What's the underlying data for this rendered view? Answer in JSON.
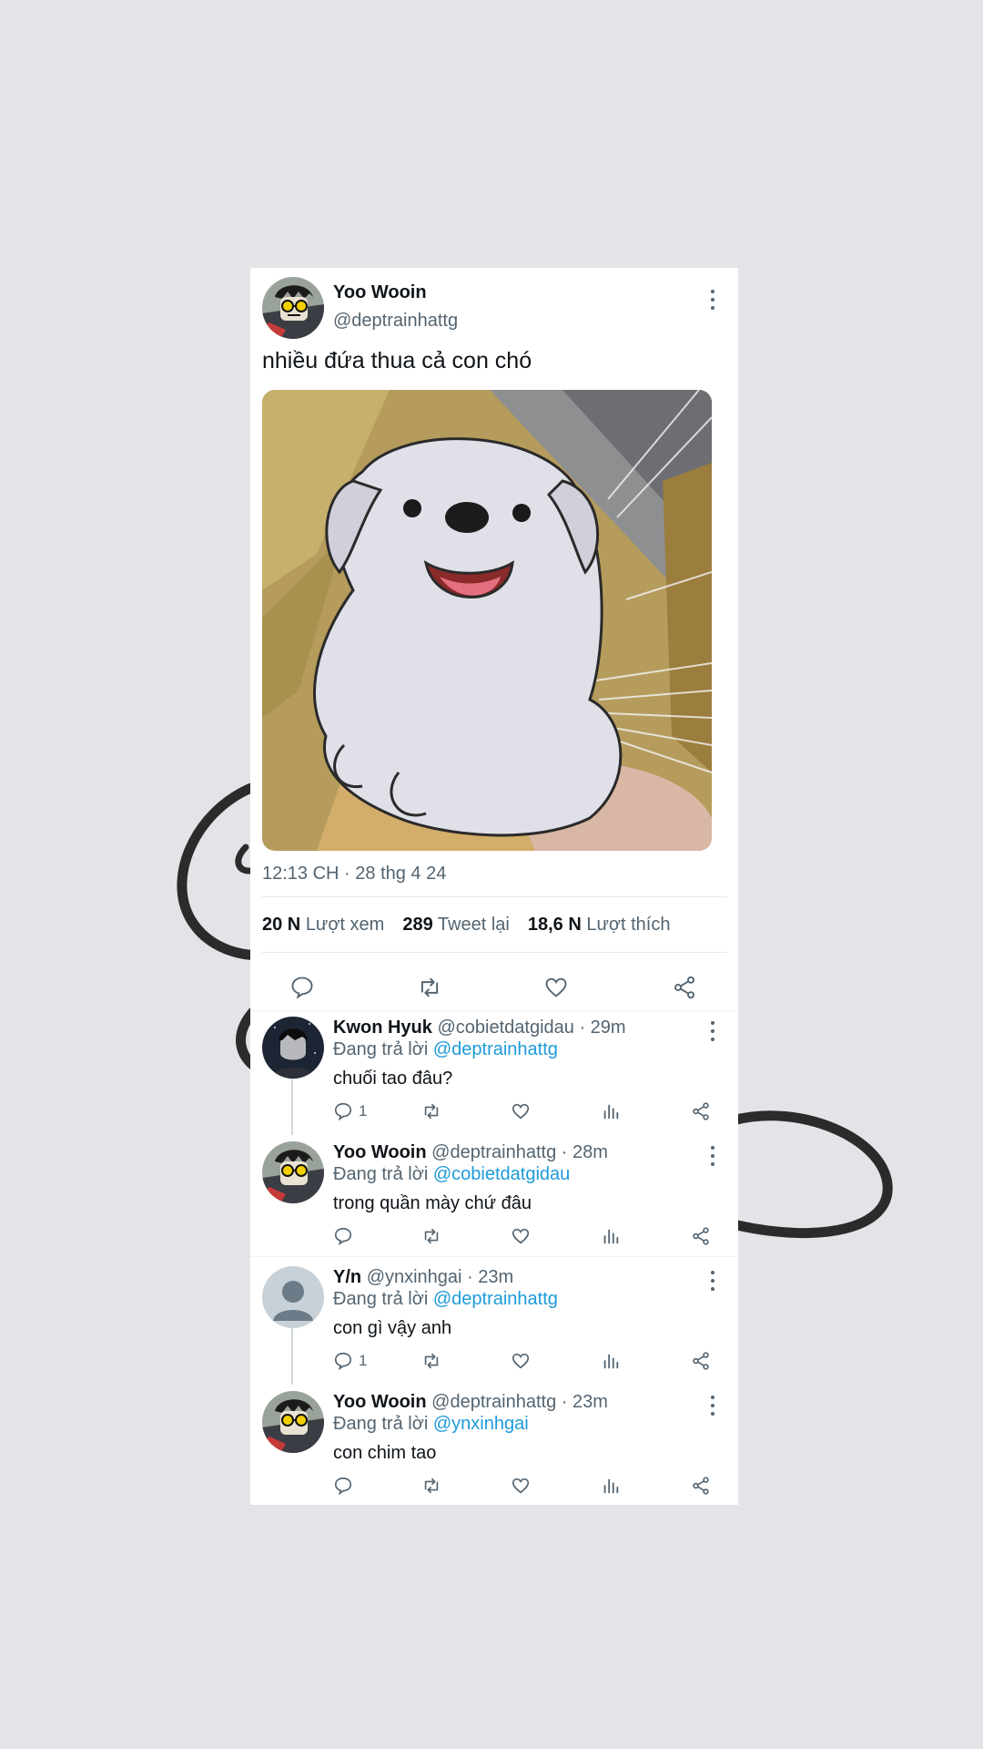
{
  "colors": {
    "background": "#e4e4e8",
    "card": "#ffffff",
    "mention": "#1d9bd9",
    "muted": "#536471"
  },
  "post": {
    "author_name": "Yoo Wooin",
    "author_handle": "@deptrainhattg",
    "text": "nhiều đứa thua cả con chó",
    "media_icon": "cartoon-puppy-image",
    "timestamp": "12:13 CH · 28 thg 4 24",
    "stats": {
      "views_count": "20 N",
      "views_label": "Lượt xem",
      "retweets_count": "289",
      "retweets_label": "Tweet lại",
      "likes_count": "18,6 N",
      "likes_label": "Lượt thích"
    }
  },
  "replies": [
    {
      "name": "Kwon Hyuk",
      "handle": "@cobietdatgidau",
      "time": "· 29m",
      "reply_prefix": "Đang trả lời",
      "reply_to": "@deptrainhattg",
      "text": "chuối tao đâu?",
      "reply_count": "1"
    },
    {
      "name": "Yoo Wooin",
      "handle": "@deptrainhattg",
      "time": "· 28m",
      "reply_prefix": "Đang trả lời",
      "reply_to": "@cobietdatgidau",
      "text": "trong quần mày chứ đâu",
      "reply_count": ""
    },
    {
      "name": "Y/n",
      "handle": "@ynxinhgai",
      "time": "· 23m",
      "reply_prefix": "Đang trả lời",
      "reply_to": "@deptrainhattg",
      "text": "con gì vậy anh",
      "reply_count": "1"
    },
    {
      "name": "Yoo Wooin",
      "handle": "@deptrainhattg",
      "time": "· 23m",
      "reply_prefix": "Đang trả lời",
      "reply_to": "@ynxinhgai",
      "text": "con chim tao",
      "reply_count": ""
    }
  ]
}
